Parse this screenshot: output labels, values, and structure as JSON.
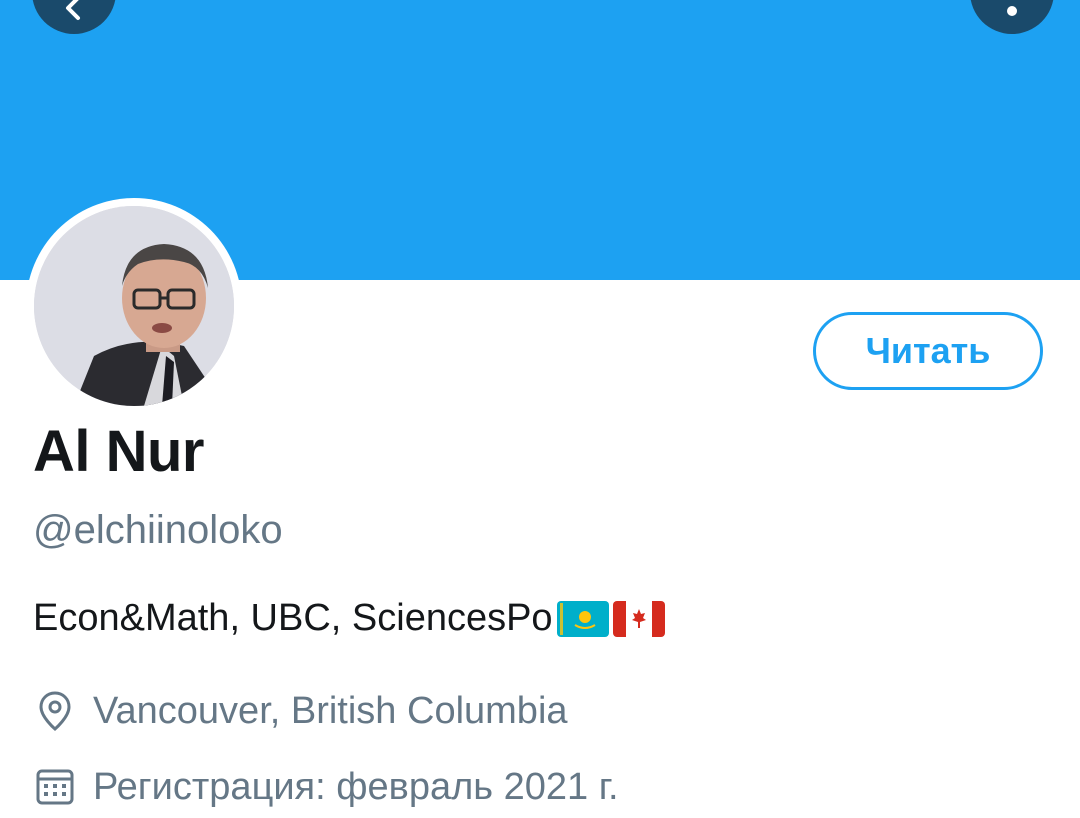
{
  "header": {
    "back_icon": "chevron-left-icon",
    "more_icon": "more-vertical-icon",
    "banner_color": "#1DA1F2"
  },
  "profile": {
    "follow_label": "Читать",
    "display_name": "Al Nur",
    "handle": "@elchiinoloko",
    "bio": "Econ&Math, UBC, SciencesPo",
    "bio_flags": [
      "kazakhstan-flag-icon",
      "canada-flag-icon"
    ],
    "location": "Vancouver, British Columbia",
    "joined": "Регистрация: февраль 2021 г."
  },
  "colors": {
    "accent": "#1DA1F2",
    "text_primary": "#14171a",
    "text_secondary": "#657786"
  }
}
